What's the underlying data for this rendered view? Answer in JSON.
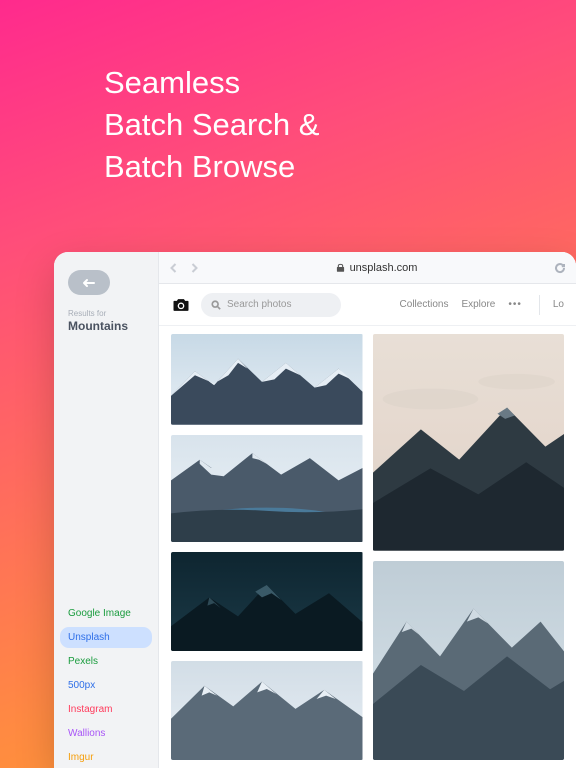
{
  "hero": {
    "line1": "Seamless",
    "line2": "Batch Search &",
    "line3": "Batch Browse"
  },
  "sidebar": {
    "results_label": "Results for",
    "query": "Mountains",
    "sources": [
      {
        "label": "Google Image",
        "color": "#1a9c3e",
        "active": false
      },
      {
        "label": "Unsplash",
        "color": "#2f6fe8",
        "active": true
      },
      {
        "label": "Pexels",
        "color": "#1a9c3e",
        "active": false
      },
      {
        "label": "500px",
        "color": "#2f6fe8",
        "active": false
      },
      {
        "label": "Instagram",
        "color": "#ff3b5c",
        "active": false
      },
      {
        "label": "Wallions",
        "color": "#a855f7",
        "active": false
      },
      {
        "label": "Imgur",
        "color": "#f59e0b",
        "active": false
      }
    ]
  },
  "browser": {
    "url": "unsplash.com"
  },
  "site_header": {
    "search_placeholder": "Search photos",
    "links": [
      "Collections",
      "Explore"
    ],
    "login_label": "Lo"
  }
}
